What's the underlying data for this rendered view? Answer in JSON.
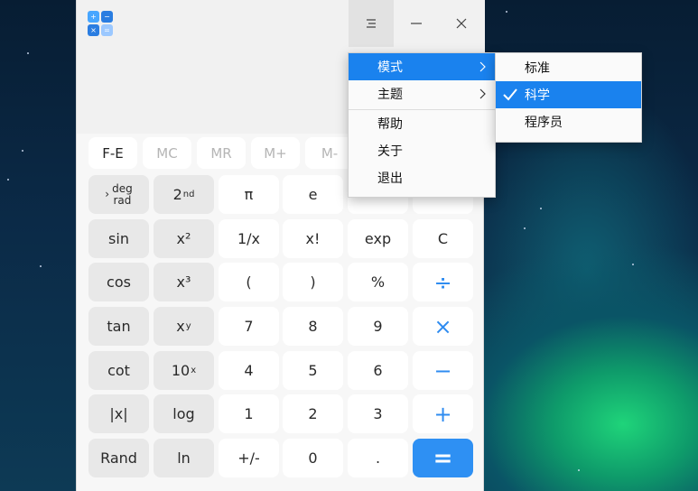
{
  "app": {
    "icon_name": "calculator-icon"
  },
  "titlebar": {
    "menu_icon": "menu-icon",
    "minimize_icon": "minimize-icon",
    "close_icon": "close-icon"
  },
  "memory_row": [
    "F-E",
    "MC",
    "MR",
    "M+",
    "M-"
  ],
  "rows": [
    [
      {
        "t": "deg/rad"
      },
      {
        "t": "2",
        "sup": "nd"
      },
      {
        "t": "π"
      },
      {
        "t": "e"
      },
      {
        "t": ""
      },
      {
        "t": ""
      }
    ],
    [
      {
        "t": "sin"
      },
      {
        "t": "x²"
      },
      {
        "t": "1/x"
      },
      {
        "t": "x!"
      },
      {
        "t": "exp"
      },
      {
        "t": "C"
      }
    ],
    [
      {
        "t": "cos"
      },
      {
        "t": "x³"
      },
      {
        "t": "("
      },
      {
        "t": ")"
      },
      {
        "t": "%"
      },
      {
        "t": "÷"
      }
    ],
    [
      {
        "t": "tan"
      },
      {
        "t": "x",
        "sup": "y"
      },
      {
        "t": "7"
      },
      {
        "t": "8"
      },
      {
        "t": "9"
      },
      {
        "t": "×"
      }
    ],
    [
      {
        "t": "cot"
      },
      {
        "t": "10",
        "sup": "x"
      },
      {
        "t": "4"
      },
      {
        "t": "5"
      },
      {
        "t": "6"
      },
      {
        "t": "−"
      }
    ],
    [
      {
        "t": "|x|"
      },
      {
        "t": "log"
      },
      {
        "t": "1"
      },
      {
        "t": "2"
      },
      {
        "t": "3"
      },
      {
        "t": "+"
      }
    ],
    [
      {
        "t": "Rand"
      },
      {
        "t": "ln"
      },
      {
        "t": "+/-"
      },
      {
        "t": "0"
      },
      {
        "t": "."
      },
      {
        "t": "="
      }
    ]
  ],
  "deg_key": {
    "top": "deg",
    "bottom": "rad"
  },
  "menu": {
    "items": [
      "模式",
      "主题",
      "帮助",
      "关于",
      "退出"
    ]
  },
  "submenu": {
    "items": [
      "标准",
      "科学",
      "程序员"
    ],
    "checked": "科学"
  },
  "colors": {
    "accent": "#2e90f3",
    "highlight": "#1a82ee"
  }
}
